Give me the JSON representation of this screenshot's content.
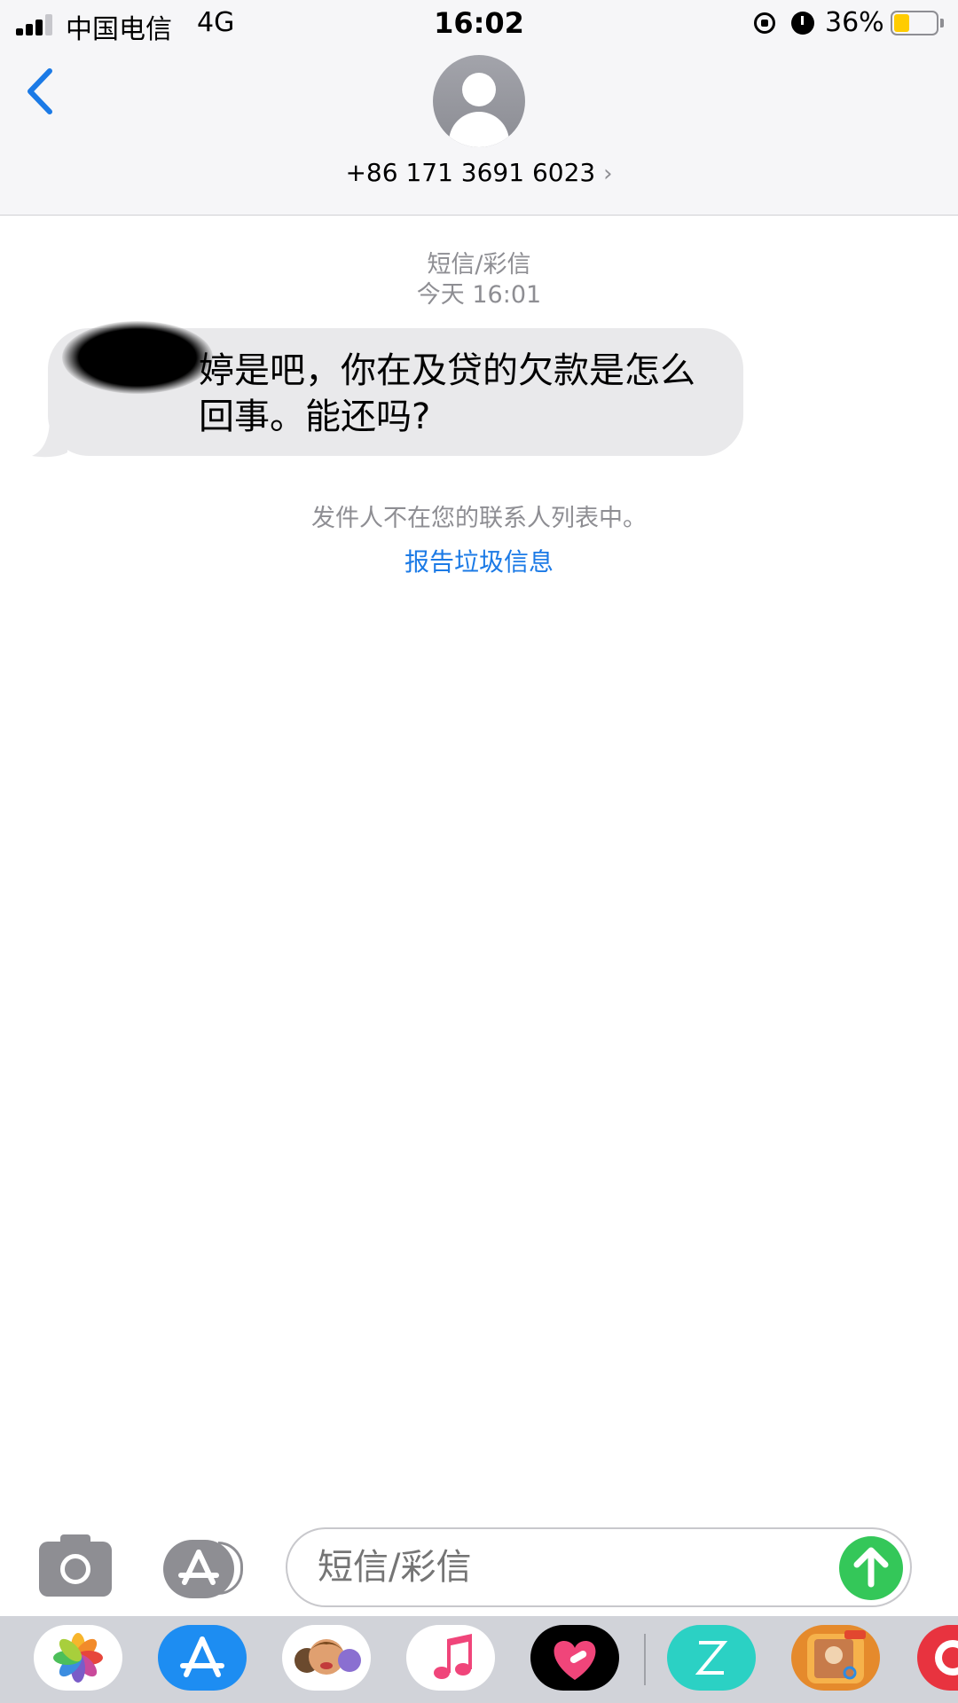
{
  "status_bar": {
    "carrier": "中国电信",
    "network": "4G",
    "time": "16:02",
    "battery_percent": "36%",
    "battery_level": 0.36
  },
  "header": {
    "contact": "+86 171 3691 6023",
    "chevron": "›"
  },
  "thread": {
    "service_label": "短信/彩信",
    "timestamp": "今天 16:01",
    "message_text": "婷是吧，你在及贷的欠款是怎么回事。能还吗?",
    "notice": "发件人不在您的联系人列表中。",
    "report_link": "报告垃圾信息"
  },
  "composer": {
    "placeholder": "短信/彩信"
  },
  "icons": {
    "back": "chevron-left-icon",
    "camera": "camera-icon",
    "apps": "app-store-icon",
    "send": "arrow-up-icon"
  },
  "colors": {
    "accent": "#1b7ae6",
    "bubble": "#e9e9eb",
    "send": "#34c759",
    "battery": "#ffcc00"
  },
  "dock_apps": [
    "Photos",
    "App Store",
    "Memoji",
    "Music",
    "Digital Touch",
    "Z",
    "Photo Editor Pro",
    "Red App"
  ]
}
